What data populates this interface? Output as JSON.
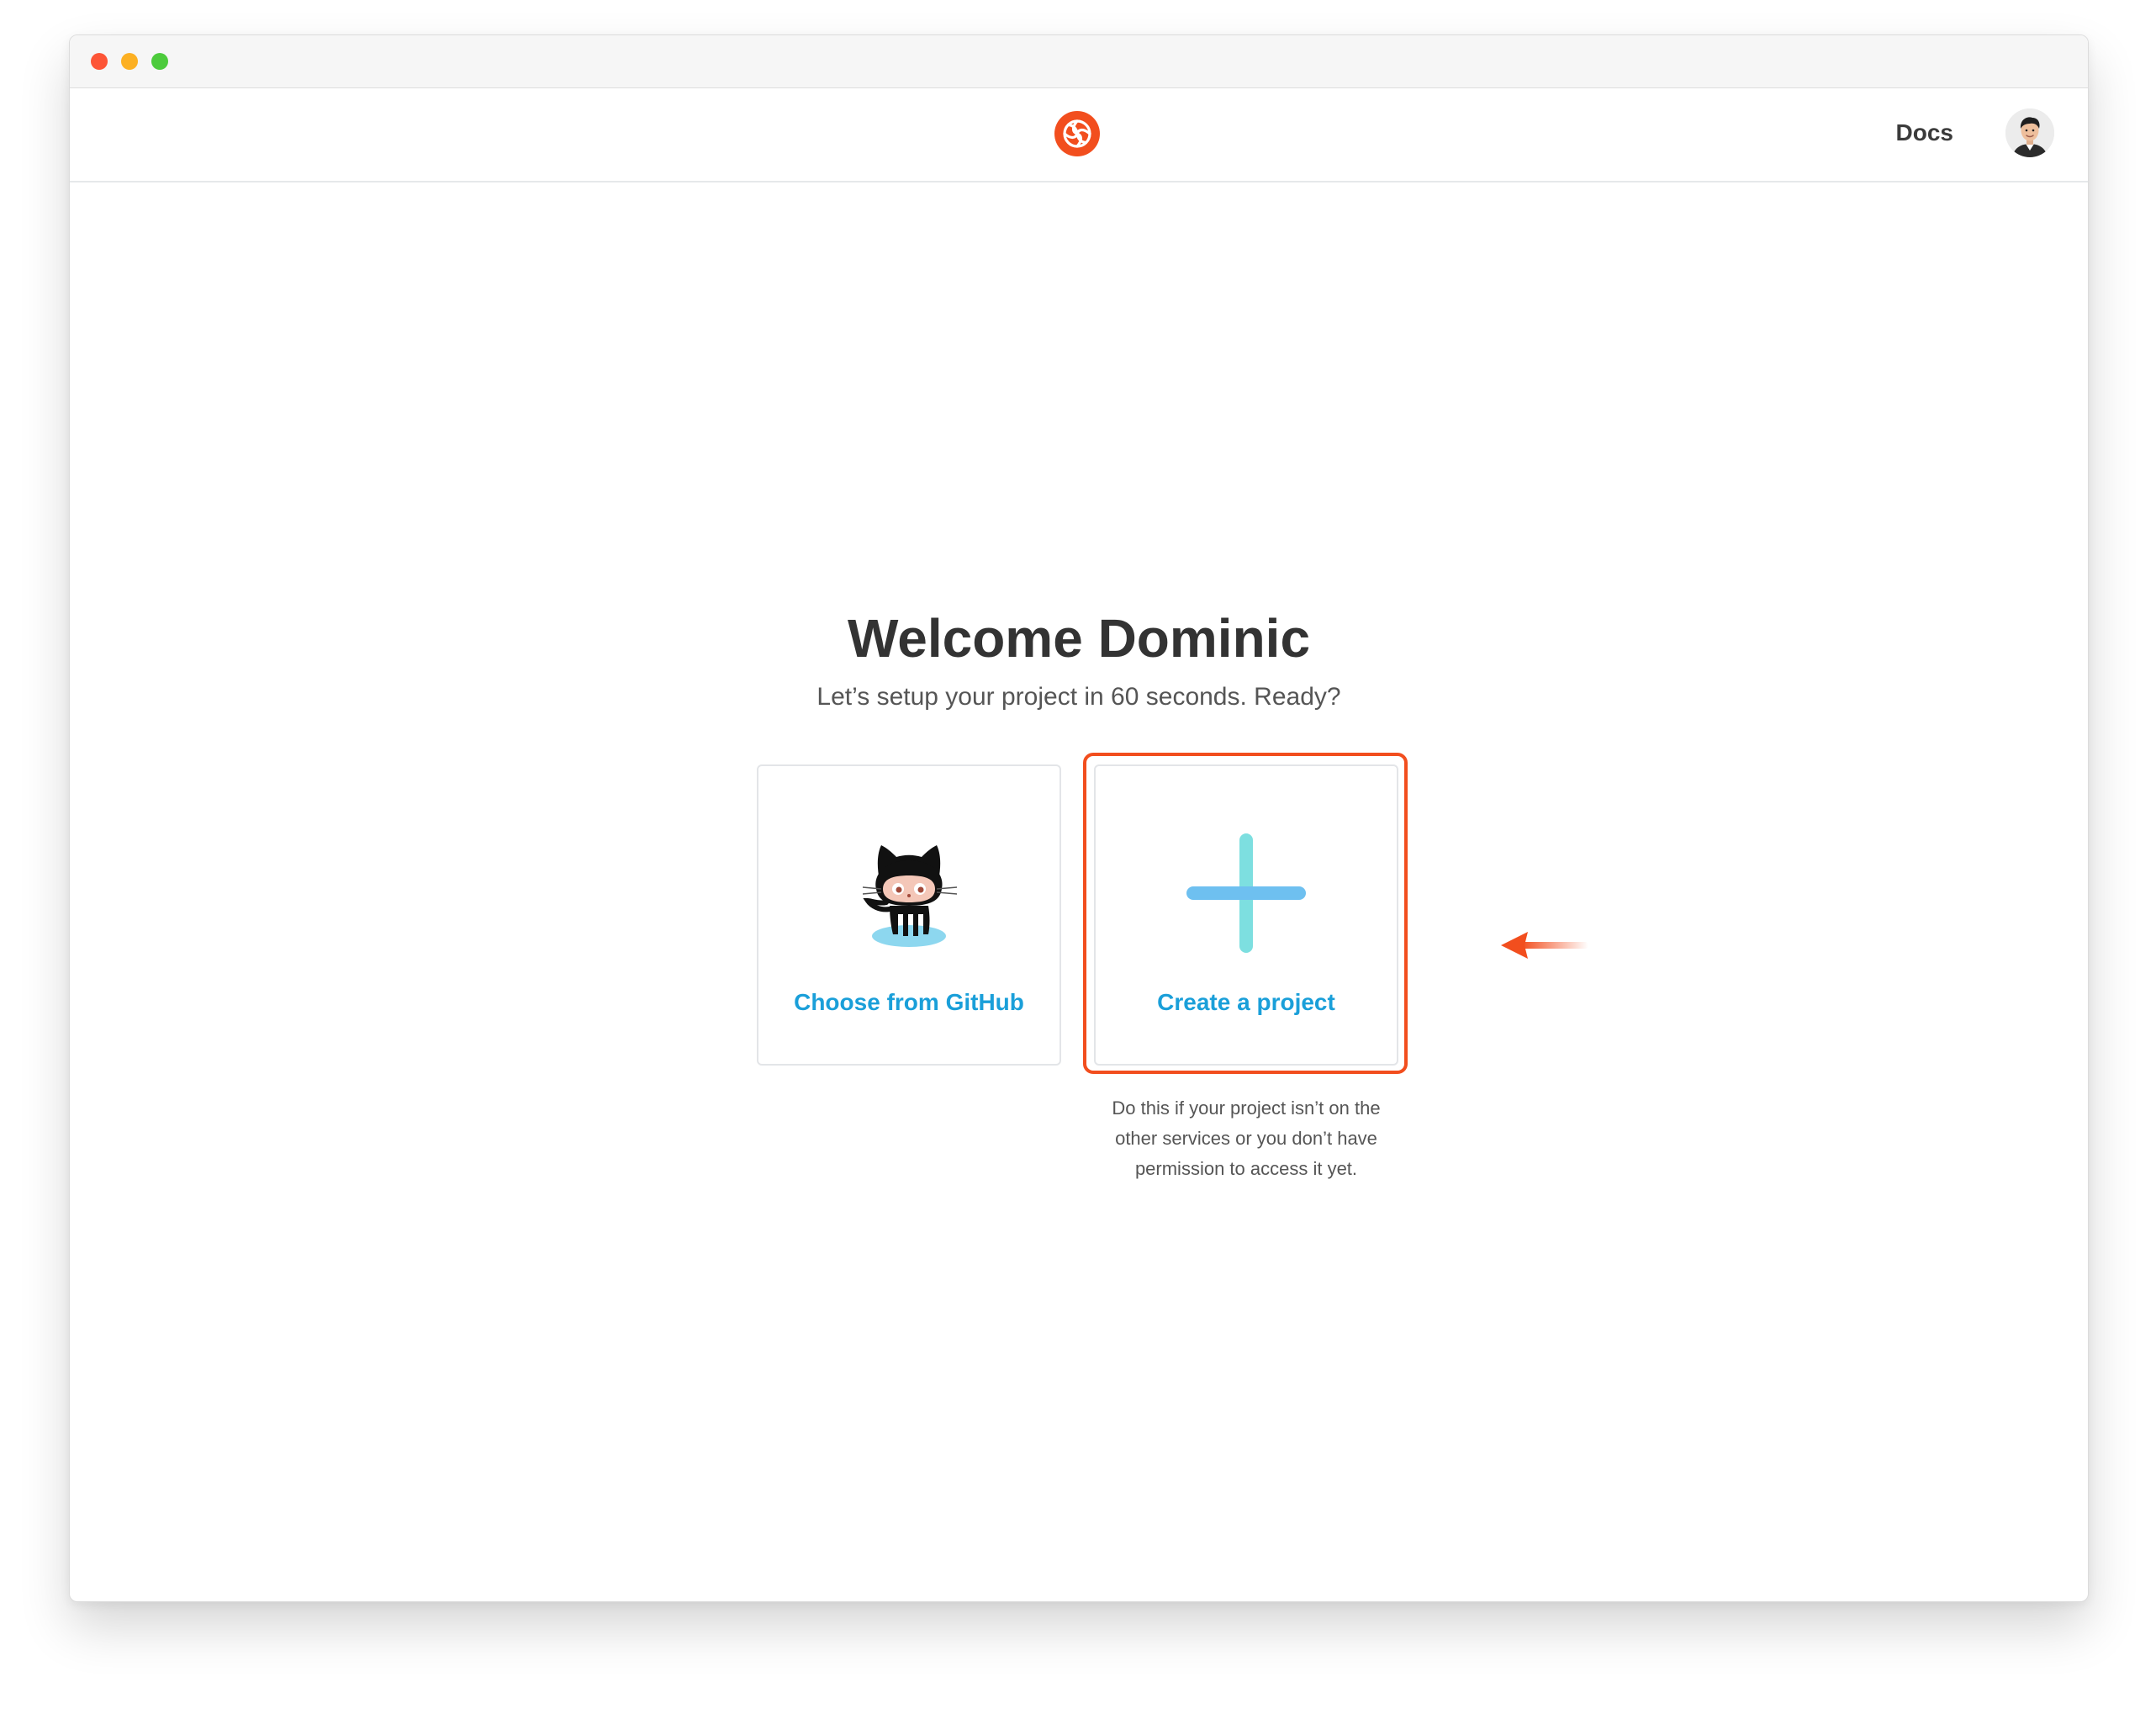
{
  "header": {
    "docs_label": "Docs"
  },
  "welcome": {
    "title": "Welcome Dominic",
    "subtitle": "Let’s setup your project in 60 seconds. Ready?"
  },
  "options": {
    "github_label": "Choose from GitHub",
    "create_label": "Create a project",
    "create_helper": "Do this if your project isn’t on the other services or you don’t have permission to access it yet."
  },
  "colors": {
    "brand": "#f24e1e",
    "link": "#1a9fd9",
    "plus_vertical": "#7ddfe0",
    "plus_horizontal": "#6ec0f0"
  },
  "icons": {
    "logo": "brand-logo-icon",
    "github": "octocat-icon",
    "create": "plus-icon",
    "annotation": "arrow-left-icon"
  }
}
